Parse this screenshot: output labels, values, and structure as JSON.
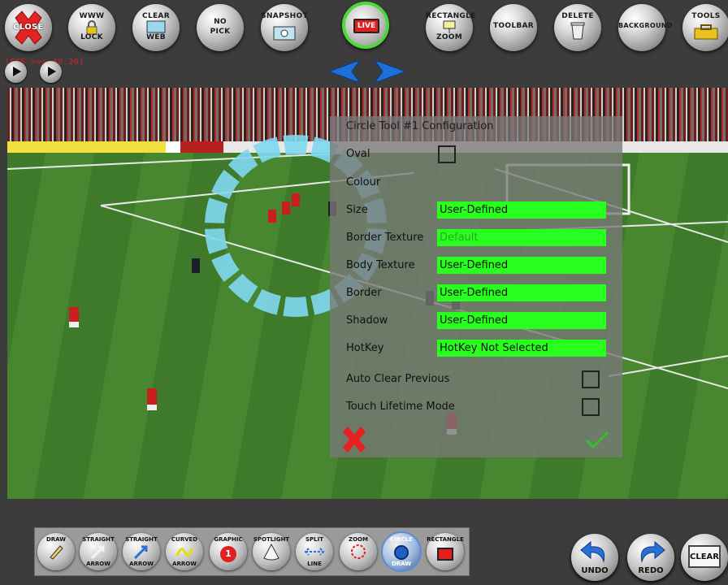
{
  "toolbar": {
    "close": "CLOSE",
    "www_lock": [
      "WWW",
      "LOCK"
    ],
    "clear_web": [
      "CLEAR",
      "WEB"
    ],
    "no_pick": [
      "NO",
      "PICK"
    ],
    "snapshot": "SNAPSHOT",
    "live": "LIVE",
    "rectangle_zoom": [
      "RECTANGLE",
      "ZOOM"
    ],
    "toolbar": "TOOLBAR",
    "delete": "DELETE",
    "background": "BACKGROUND",
    "tools": "TOOLS"
  },
  "fps_readout": "[FPS ==> 40.20]",
  "panel": {
    "title": "Circle Tool #1 Configuration",
    "rows": [
      {
        "label": "Oval",
        "type": "checkbox"
      },
      {
        "label": "Colour",
        "type": "none"
      },
      {
        "label": "Size",
        "type": "field",
        "value": "User-Defined"
      },
      {
        "label": "Border Texture",
        "type": "field",
        "value": "Default"
      },
      {
        "label": "Body Texture",
        "type": "field",
        "value": "User-Defined"
      },
      {
        "label": "Border",
        "type": "field",
        "value": "User-Defined"
      },
      {
        "label": "Shadow",
        "type": "field",
        "value": "User-Defined"
      },
      {
        "label": "HotKey",
        "type": "field",
        "value": "HotKey Not Selected"
      }
    ],
    "auto_clear": "Auto Clear Previous",
    "touch_lifetime": "Touch Lifetime Mode"
  },
  "bottom_tools": {
    "draw": "DRAW",
    "straight_arrow": [
      "STRAIGHT",
      "ARROW"
    ],
    "straight_arrow2": [
      "STRAIGHT",
      "ARROW"
    ],
    "curved_arrow": [
      "CURVED",
      "ARROW"
    ],
    "graphic": "GRAPHIC",
    "graphic_number": "1",
    "spotlight": "SPOTLIGHT",
    "split_line": [
      "SPLIT",
      "LINE"
    ],
    "zoom": "ZOOM",
    "circle_draw": [
      "CIRCLE",
      "DRAW"
    ],
    "rectangle": "RECTANGLE"
  },
  "actions": {
    "undo": "UNDO",
    "redo": "REDO",
    "clear": "CLEAR"
  },
  "colors": {
    "field_green": "#29ff1f",
    "live_ring": "#4fd83a",
    "segment_blue": "#7fd8ef",
    "nav_blue": "#1f6fd8"
  }
}
